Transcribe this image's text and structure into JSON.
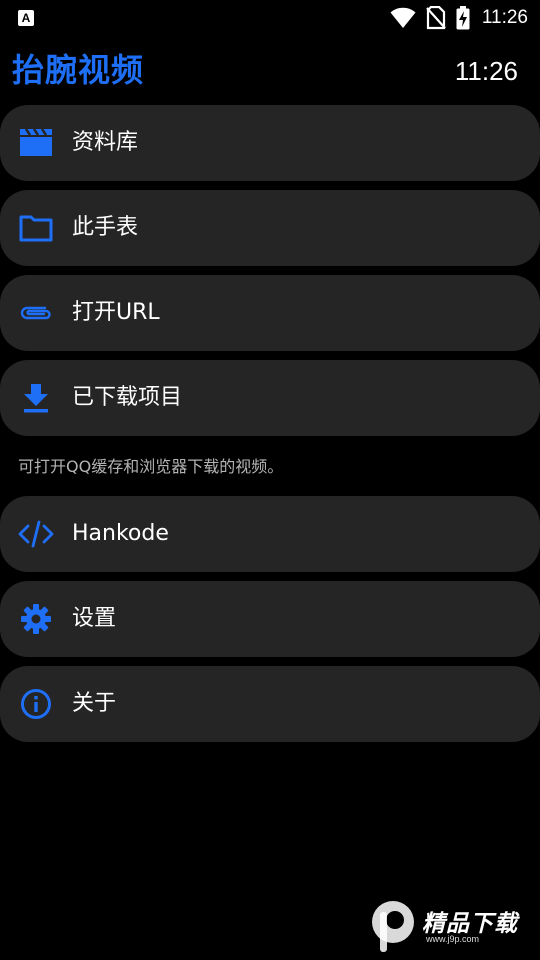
{
  "status_bar": {
    "app_icon_letter": "A",
    "time": "11:26",
    "icons": [
      "wifi-icon",
      "no-sim-icon",
      "battery-charging-icon"
    ]
  },
  "header": {
    "title": "抬腕视频",
    "clock": "11:26"
  },
  "menu": {
    "items": [
      {
        "label": "资料库",
        "icon": "clapperboard-icon"
      },
      {
        "label": "此手表",
        "icon": "folder-icon"
      },
      {
        "label": "打开URL",
        "icon": "link-icon"
      },
      {
        "label": "已下载项目",
        "icon": "download-icon"
      }
    ],
    "hint": "可打开QQ缓存和浏览器下载的视频。",
    "items_secondary": [
      {
        "label": "Hankode",
        "icon": "code-icon"
      },
      {
        "label": "设置",
        "icon": "gear-icon"
      },
      {
        "label": "关于",
        "icon": "info-icon"
      }
    ]
  },
  "watermark": {
    "text": "精品下载",
    "url": "www.j9p.com"
  },
  "colors": {
    "background": "#000000",
    "card": "#252525",
    "accent": "#1e6ff5",
    "text": "#ffffff",
    "hint": "#b3b3b3"
  }
}
